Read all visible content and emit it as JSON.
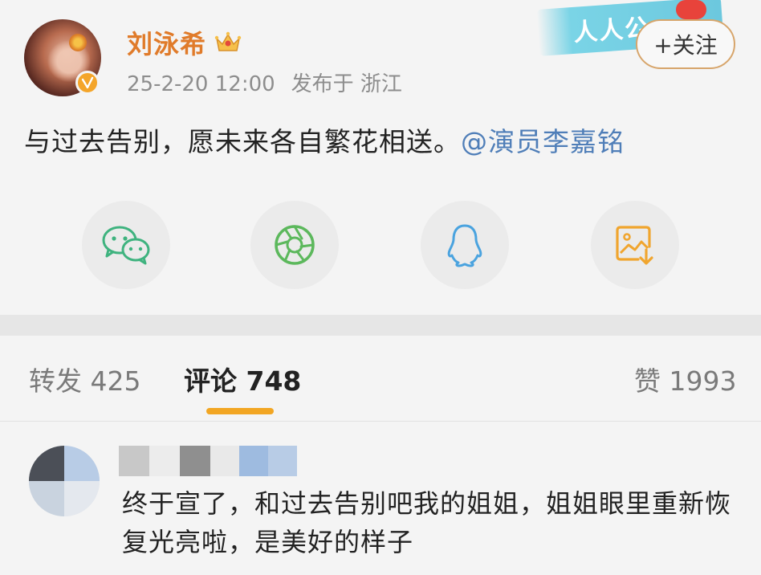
{
  "user": {
    "name": "刘泳希",
    "date": "25-2-20 12:00",
    "location": "发布于 浙江"
  },
  "stamp_text": "人人公",
  "follow_label": "+关注",
  "post": {
    "text": "与过去告别，愿未来各自繁花相送。",
    "mention": "@演员李嘉铭"
  },
  "share": [
    {
      "icon": "wechat-icon",
      "color": "#3fb37f"
    },
    {
      "icon": "moments-icon",
      "color": "#5cb85c"
    },
    {
      "icon": "qq-icon",
      "color": "#4aa3df"
    },
    {
      "icon": "save-image-icon",
      "color": "#f0a52e"
    }
  ],
  "tabs": {
    "repost": "转发 425",
    "comments": "评论 748",
    "likes": "赞 1993"
  },
  "comment": {
    "text": "终于宣了，和过去告别吧我的姐姐，姐姐眼里重新恢复光亮啦，是美好的样子"
  },
  "colors": {
    "accent": "#f2a623",
    "name": "#e07b2a",
    "mention": "#4f7eb8"
  }
}
